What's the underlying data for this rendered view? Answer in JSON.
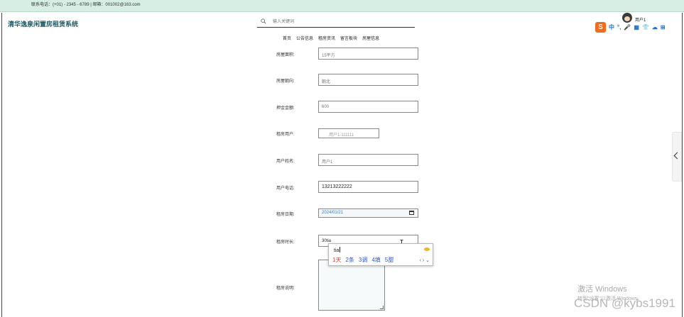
{
  "topbar": {
    "contact": "联系电话：(+01) - 2345 - 6789 | 邮箱：001002@163.com"
  },
  "site": {
    "title": "清华逸泉闲置房租赁系统"
  },
  "search": {
    "placeholder": "输入关键词"
  },
  "nav": {
    "items": [
      "首页",
      "公告信息",
      "租房资讯",
      "留言板块",
      "房屋信息"
    ]
  },
  "user": {
    "name": "用户1"
  },
  "ime_toolbar": {
    "logo": "S",
    "items": [
      "中",
      "°,",
      "🎤",
      "▦",
      "👕",
      "☁",
      "⊞"
    ]
  },
  "form": {
    "area": {
      "label": "房屋面积:",
      "value": "15平方"
    },
    "orientation": {
      "label": "房屋朝向:",
      "value": "朝北"
    },
    "deposit": {
      "label": "押金金额:",
      "value": "600"
    },
    "tenant_account": {
      "label": "租房用户:",
      "value": "用户1-111111"
    },
    "user_name": {
      "label": "用户姓名:",
      "value": "用户1"
    },
    "phone": {
      "label": "用户电话:",
      "value": "13213222222"
    },
    "rent_date": {
      "label": "租房日期:",
      "value": "2024/01/21"
    },
    "duration": {
      "label": "租房时长:",
      "value": "30tia"
    },
    "remark": {
      "label": "租房说明:"
    }
  },
  "ime_popup": {
    "pinyin": "tia",
    "candidates": [
      "1天",
      "2条",
      "3调",
      "4填",
      "5甜"
    ],
    "arrows": "‹ › ⌄"
  },
  "windows_watermark": {
    "line1": "激活 Windows",
    "line2": "转到\"设置\"以激活 Windows。"
  },
  "csdn_watermark": "CSDN @kybs1991"
}
